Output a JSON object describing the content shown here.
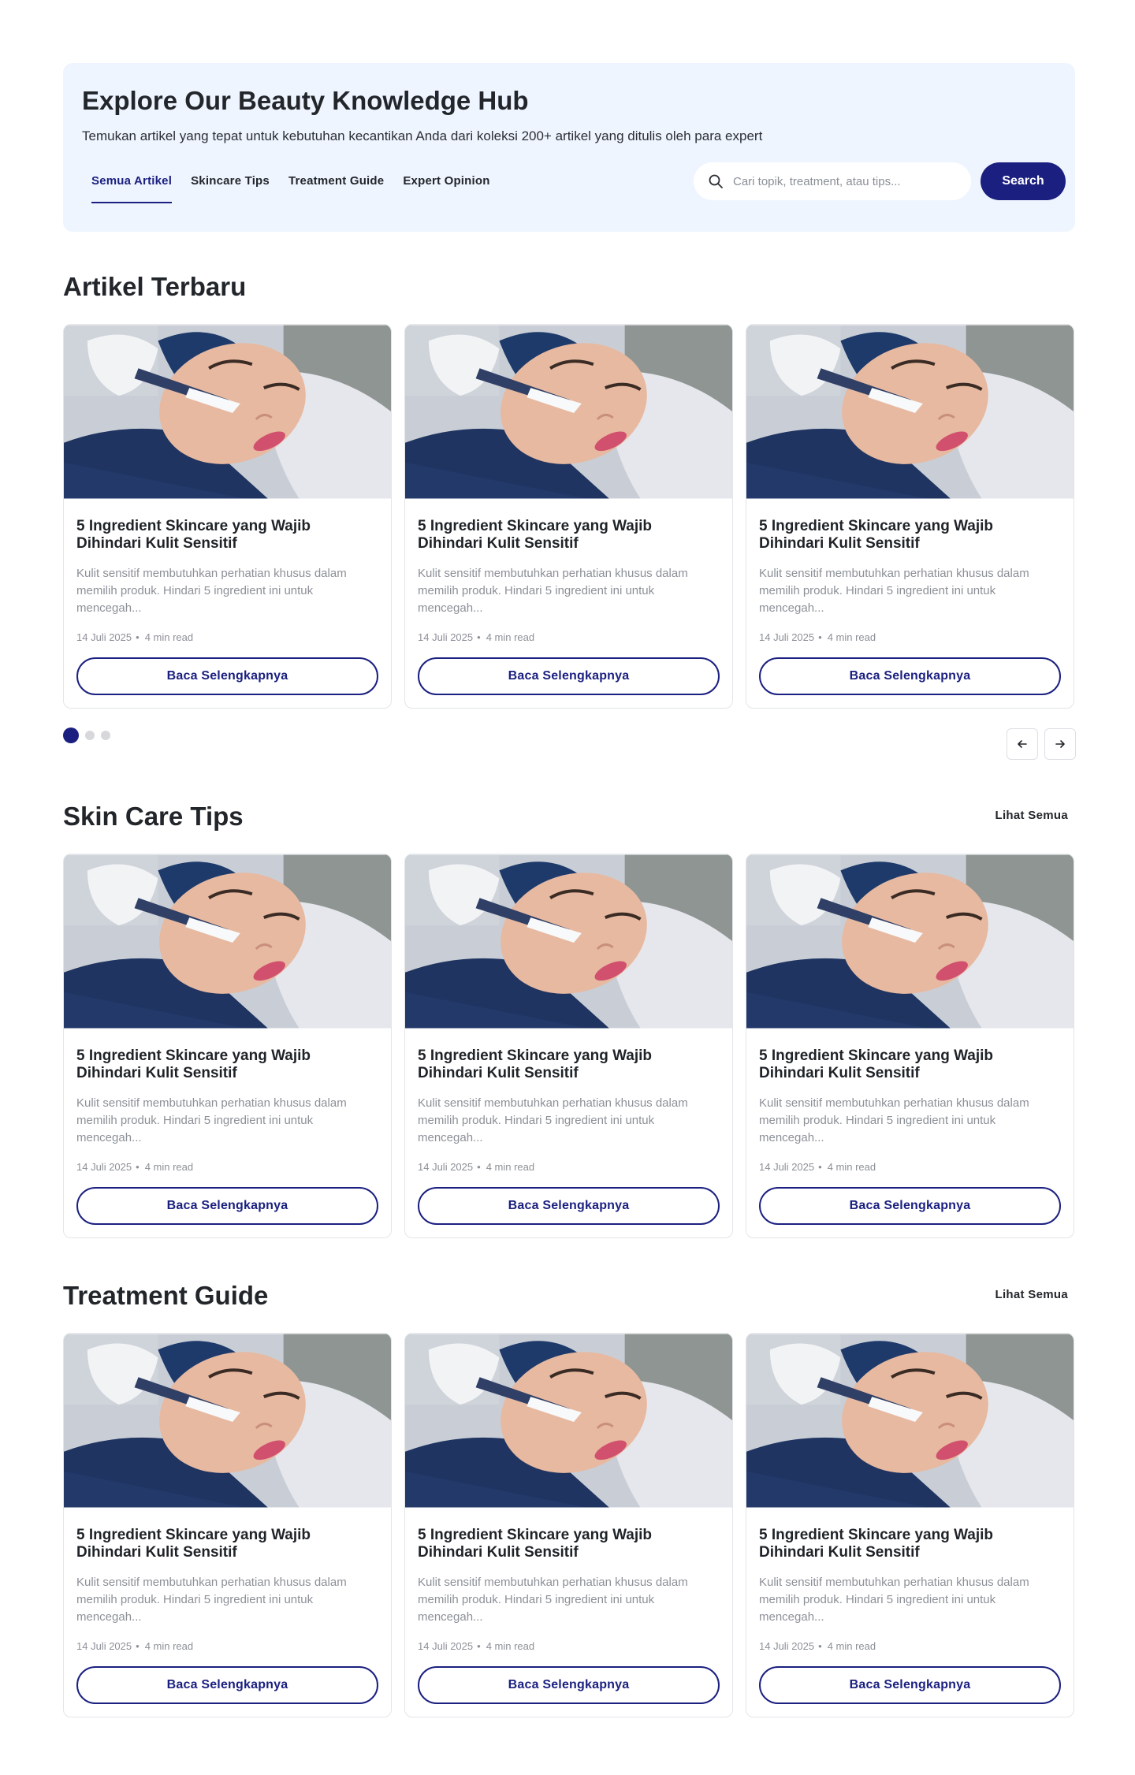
{
  "hero": {
    "title": "Explore Our Beauty Knowledge Hub",
    "subtitle": "Temukan artikel yang tepat untuk kebutuhan kecantikan Anda dari koleksi 200+ artikel yang ditulis oleh para expert",
    "tabs": [
      {
        "label": "Semua Artikel",
        "active": true
      },
      {
        "label": "Skincare Tips",
        "active": false
      },
      {
        "label": "Treatment Guide",
        "active": false
      },
      {
        "label": "Expert Opinion",
        "active": false
      }
    ],
    "search": {
      "placeholder": "Cari topik, treatment, atau tips...",
      "value": "",
      "icon": "search-icon"
    },
    "search_button": "Search"
  },
  "sections": [
    {
      "title": "Artikel Terbaru",
      "see_all": "",
      "carousel": {
        "pages": 3,
        "current": 1,
        "prev_icon": "arrow-left-icon",
        "next_icon": "arrow-right-icon"
      },
      "cards": [
        {
          "title": "5 Ingredient Skincare yang Wajib Dihindari Kulit Sensitif",
          "excerpt": "Kulit sensitif membutuhkan perhatian khusus dalam memilih produk. Hindari 5 ingredient ini untuk mencegah...",
          "date": "14 Juli 2025",
          "read": "4 min read",
          "button": "Baca Selengkapnya"
        },
        {
          "title": "5 Ingredient Skincare yang Wajib Dihindari Kulit Sensitif",
          "excerpt": "Kulit sensitif membutuhkan perhatian khusus dalam memilih produk. Hindari 5 ingredient ini untuk mencegah...",
          "date": "14 Juli 2025",
          "read": "4 min read",
          "button": "Baca Selengkapnya"
        },
        {
          "title": "5 Ingredient Skincare yang Wajib Dihindari Kulit Sensitif",
          "excerpt": "Kulit sensitif membutuhkan perhatian khusus dalam memilih produk. Hindari 5 ingredient ini untuk mencegah...",
          "date": "14 Juli 2025",
          "read": "4 min read",
          "button": "Baca Selengkapnya"
        }
      ]
    },
    {
      "title": "Skin Care Tips",
      "see_all": "Lihat Semua",
      "cards": [
        {
          "title": "5 Ingredient Skincare yang Wajib Dihindari Kulit Sensitif",
          "excerpt": "Kulit sensitif membutuhkan perhatian khusus dalam memilih produk. Hindari 5 ingredient ini untuk mencegah...",
          "date": "14 Juli 2025",
          "read": "4 min read",
          "button": "Baca Selengkapnya"
        },
        {
          "title": "5 Ingredient Skincare yang Wajib Dihindari Kulit Sensitif",
          "excerpt": "Kulit sensitif membutuhkan perhatian khusus dalam memilih produk. Hindari 5 ingredient ini untuk mencegah...",
          "date": "14 Juli 2025",
          "read": "4 min read",
          "button": "Baca Selengkapnya"
        },
        {
          "title": "5 Ingredient Skincare yang Wajib Dihindari Kulit Sensitif",
          "excerpt": "Kulit sensitif membutuhkan perhatian khusus dalam memilih produk. Hindari 5 ingredient ini untuk mencegah...",
          "date": "14 Juli 2025",
          "read": "4 min read",
          "button": "Baca Selengkapnya"
        }
      ]
    },
    {
      "title": "Treatment Guide",
      "see_all": "Lihat Semua",
      "cards": [
        {
          "title": "5 Ingredient Skincare yang Wajib Dihindari Kulit Sensitif",
          "excerpt": "Kulit sensitif membutuhkan perhatian khusus dalam memilih produk. Hindari 5 ingredient ini untuk mencegah...",
          "date": "14 Juli 2025",
          "read": "4 min read",
          "button": "Baca Selengkapnya"
        },
        {
          "title": "5 Ingredient Skincare yang Wajib Dihindari Kulit Sensitif",
          "excerpt": "Kulit sensitif membutuhkan perhatian khusus dalam memilih produk. Hindari 5 ingredient ini untuk mencegah...",
          "date": "14 Juli 2025",
          "read": "4 min read",
          "button": "Baca Selengkapnya"
        },
        {
          "title": "5 Ingredient Skincare yang Wajib Dihindari Kulit Sensitif",
          "excerpt": "Kulit sensitif membutuhkan perhatian khusus dalam memilih produk. Hindari 5 ingredient ini untuk mencegah...",
          "date": "14 Juli 2025",
          "read": "4 min read",
          "button": "Baca Selengkapnya"
        }
      ]
    }
  ],
  "colors": {
    "primary": "#1b2080",
    "hero_bg": "#eff5ff",
    "muted_text": "#8c9097",
    "border": "#e3e5e8"
  }
}
